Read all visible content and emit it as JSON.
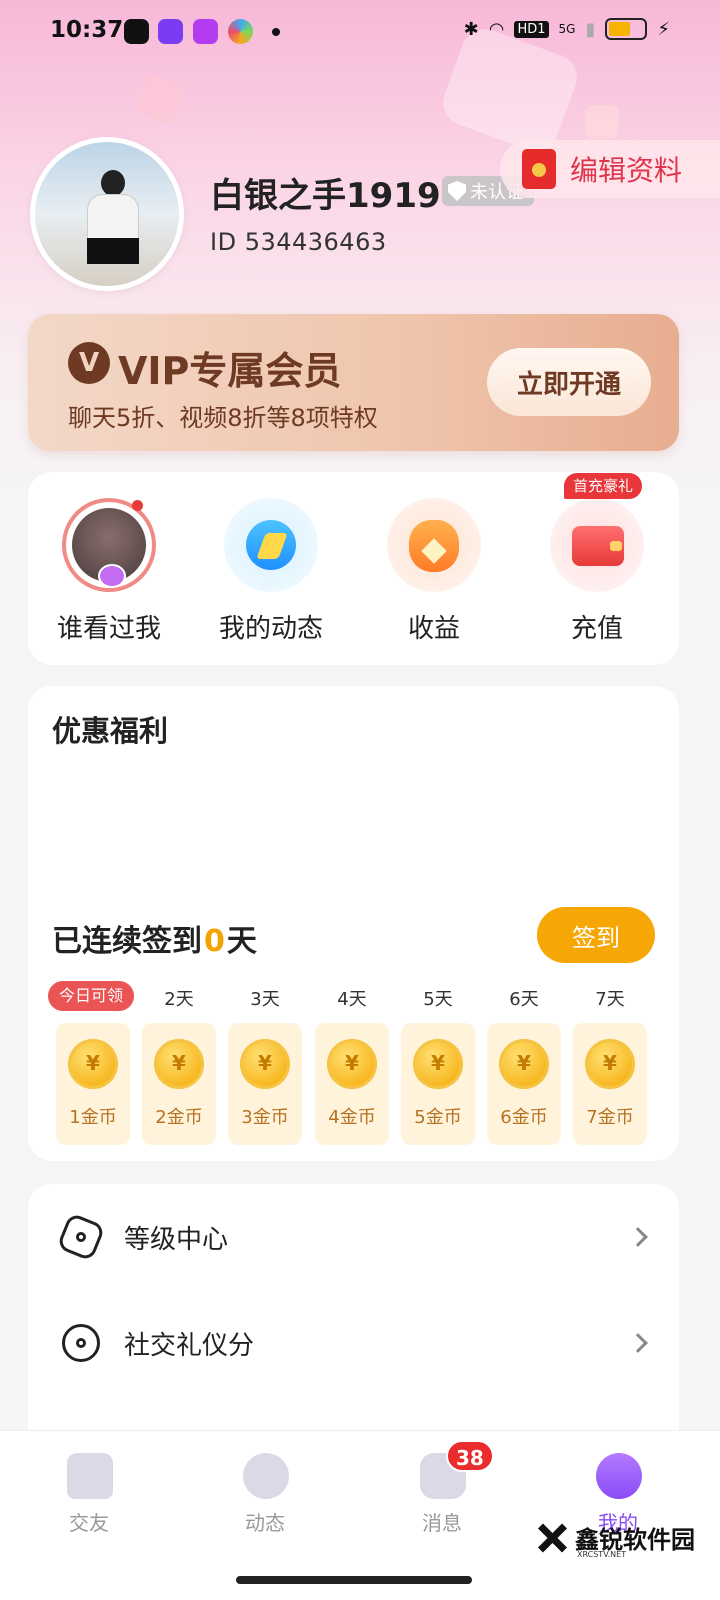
{
  "status_bar": {
    "time": "10:37",
    "network_label": "HD1",
    "signal_label": "5G"
  },
  "profile": {
    "username": "白银之手1919",
    "verify_label": "未认证",
    "user_id": "ID 534436463",
    "edit_label": "编辑资料"
  },
  "vip": {
    "logo": "V",
    "title": "VIP专属会员",
    "subtitle": "聊天5折、视频8折等8项特权",
    "button": "立即开通"
  },
  "actions": [
    {
      "label": "谁看过我",
      "icon": "visitor-avatar-icon"
    },
    {
      "label": "我的动态",
      "icon": "moments-icon"
    },
    {
      "label": "收益",
      "icon": "money-bag-icon"
    },
    {
      "label": "充值",
      "icon": "wallet-icon"
    }
  ],
  "first_gift_tag": "首充豪礼",
  "welfare": {
    "title": "优惠福利",
    "checkin_prefix": "已连续签到",
    "checkin_days": "0",
    "checkin_suffix": "天",
    "checkin_button": "签到",
    "today_tag": "今日可领",
    "coin_symbol": "¥",
    "days": [
      {
        "day": "",
        "reward": "1金币"
      },
      {
        "day": "2天",
        "reward": "2金币"
      },
      {
        "day": "3天",
        "reward": "3金币"
      },
      {
        "day": "4天",
        "reward": "4金币"
      },
      {
        "day": "5天",
        "reward": "5金币"
      },
      {
        "day": "6天",
        "reward": "6金币"
      },
      {
        "day": "7天",
        "reward": "7金币"
      }
    ]
  },
  "menu": [
    {
      "label": "等级中心",
      "icon": "badge-icon"
    },
    {
      "label": "社交礼仪分",
      "icon": "flower-icon"
    }
  ],
  "tabs": [
    {
      "label": "交友",
      "icon": "home-heart-icon",
      "active": false
    },
    {
      "label": "动态",
      "icon": "leaf-icon",
      "active": false
    },
    {
      "label": "消息",
      "icon": "chat-icon",
      "active": false
    },
    {
      "label": "我的",
      "icon": "profile-icon",
      "active": true
    }
  ],
  "message_badge": "38",
  "watermark": {
    "title": "鑫锐软件园",
    "sub": "XRCSTV.NET"
  },
  "colors": {
    "accent": "#f7a705",
    "vip_brown": "#6e3a24",
    "tab_active": "#8a4bf7",
    "badge_red": "#ea2c2c"
  }
}
